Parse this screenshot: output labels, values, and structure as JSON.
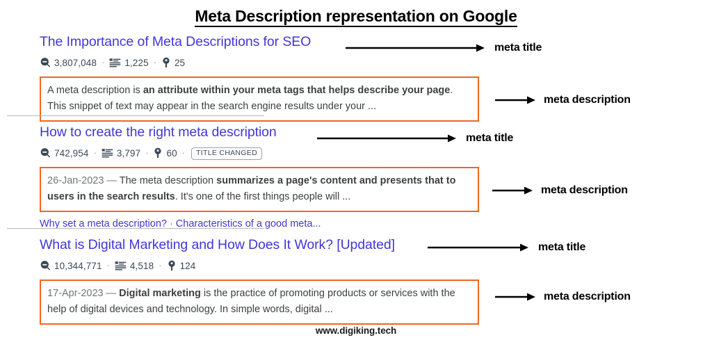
{
  "title": "Meta Description representation on Google",
  "footer": "www.digiking.tech",
  "colors": {
    "box_border": "#f2661c",
    "link": "#4236d6",
    "metric_text": "#3c4856",
    "body_text": "#3c4043",
    "date_text": "#70757a"
  },
  "annotation_labels": {
    "meta_title": "meta title",
    "meta_description": "meta description"
  },
  "results": [
    {
      "title": "The Importance of Meta Descriptions for SEO",
      "metrics": {
        "search_volume_icon": "search-bubble-icon",
        "search_volume": "3,807,048",
        "rank_icon": "ranking-list-icon",
        "rank": "1,225",
        "keyword_icon": "key-icon",
        "keywords": "25",
        "badge": ""
      },
      "description": {
        "date": "",
        "parts": [
          {
            "text": "A meta description is ",
            "bold": false
          },
          {
            "text": "an attribute within your meta tags that helps describe your page",
            "bold": true
          },
          {
            "text": ". This snippet of text may appear in the search engine results under your ...",
            "bold": false
          }
        ]
      },
      "sitelinks": []
    },
    {
      "title": "How to create the right meta description",
      "metrics": {
        "search_volume_icon": "search-bubble-icon",
        "search_volume": "742,954",
        "rank_icon": "ranking-list-icon",
        "rank": "3,797",
        "keyword_icon": "key-icon",
        "keywords": "60",
        "badge": "TITLE CHANGED"
      },
      "description": {
        "date": "26-Jan-2023 — ",
        "parts": [
          {
            "text": "The meta description ",
            "bold": false
          },
          {
            "text": "summarizes a page's content and presents that to users in the search results",
            "bold": true
          },
          {
            "text": ". It's one of the first things people will ...",
            "bold": false
          }
        ]
      },
      "sitelinks": [
        "Why set a meta description?",
        "Characteristics of a good meta..."
      ]
    },
    {
      "title": "What is Digital Marketing and How Does It Work? [Updated]",
      "metrics": {
        "search_volume_icon": "search-bubble-icon",
        "search_volume": "10,344,771",
        "rank_icon": "ranking-list-icon",
        "rank": "4,518",
        "keyword_icon": "key-icon",
        "keywords": "124",
        "badge": ""
      },
      "description": {
        "date": "17-Apr-2023 — ",
        "parts": [
          {
            "text": "Digital marketing",
            "bold": true
          },
          {
            "text": " is the practice of promoting products or services with the help of digital devices and technology. In simple words, digital ...",
            "bold": false
          }
        ]
      },
      "sitelinks": []
    }
  ]
}
